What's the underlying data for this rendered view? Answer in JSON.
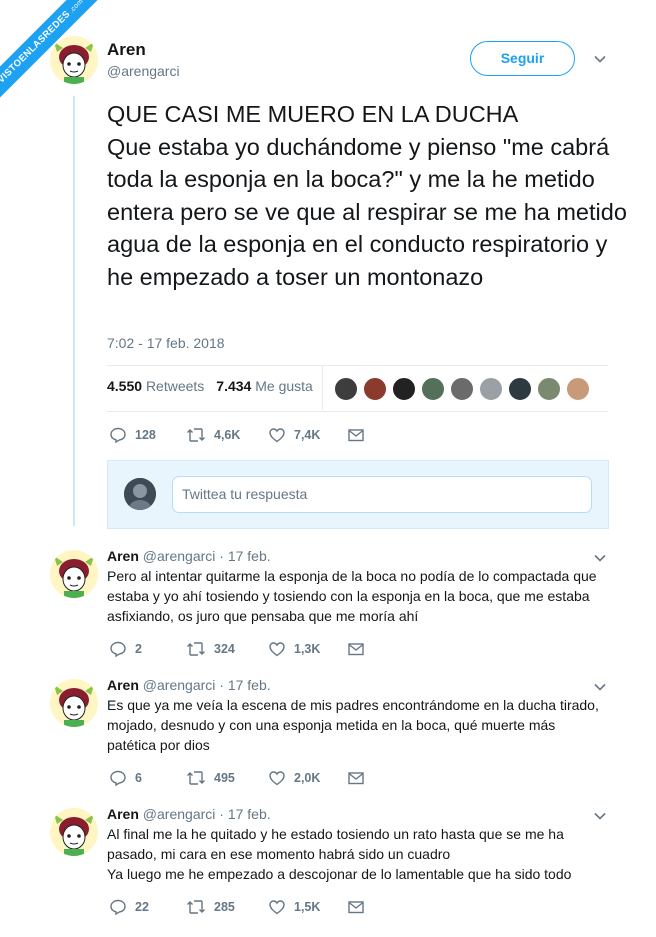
{
  "watermark": {
    "text": "VISTOENLASREDES",
    "sub": ".com"
  },
  "main_tweet": {
    "author_name": "Aren",
    "author_handle": "@arengarci",
    "follow_label": "Seguir",
    "text": "QUE CASI ME MUERO EN LA DUCHA\nQue estaba yo duchándome y pienso \"me cabrá toda la esponja en la boca?\" y me la he metido entera pero se ve que al respirar se me ha metido agua de la esponja en el conducto respiratorio y he empezado a toser un montonazo",
    "timestamp": "7:02 - 17 feb. 2018",
    "retweets_count": "4.550",
    "retweets_label": "Retweets",
    "likes_count": "7.434",
    "likes_label": "Me gusta",
    "reply_count": "128",
    "retweet_action_count": "4,6K",
    "like_action_count": "7,4K",
    "liker_colors": [
      "#3d3d3d",
      "#8a3b2e",
      "#222222",
      "#55705a",
      "#6b6b6b",
      "#9aa0a6",
      "#2e3a40",
      "#7a8a70",
      "#c99a7a"
    ]
  },
  "reply_box": {
    "placeholder": "Twittea tu respuesta"
  },
  "replies": [
    {
      "name": "Aren",
      "handle": "@arengarci",
      "date": "· 17 feb.",
      "lines": [
        "Pero al intentar quitarme la esponja de la boca no podía de lo compactada que",
        "estaba y yo ahí tosiendo y tosiendo con la esponja en la boca, que me estaba",
        "asfixiando, os juro que pensaba que me moría ahí"
      ],
      "reply_count": "2",
      "retweet_count": "324",
      "like_count": "1,3K"
    },
    {
      "name": "Aren",
      "handle": "@arengarci",
      "date": "· 17 feb.",
      "lines": [
        "Es que ya me veía la escena de mis padres encontrándome en la ducha tirado,",
        "mojado, desnudo y con una esponja metida en la boca, qué muerte más",
        "patética por dios"
      ],
      "reply_count": "6",
      "retweet_count": "495",
      "like_count": "2,0K"
    },
    {
      "name": "Aren",
      "handle": "@arengarci",
      "date": "· 17 feb.",
      "lines": [
        "Al final me la he quitado y he estado tosiendo un rato hasta que se me ha",
        "pasado, mi cara en ese momento habrá sido un cuadro",
        "Ya luego me he empezado a descojonar de lo lamentable que ha sido todo"
      ],
      "reply_count": "22",
      "retweet_count": "285",
      "like_count": "1,5K"
    }
  ],
  "colors": {
    "accent": "#1da1f2",
    "muted": "#657786",
    "text": "#14171a",
    "border": "#e6ecf0",
    "reply_box_bg": "#e8f5fd"
  },
  "icons": [
    "reply-icon",
    "retweet-icon",
    "like-icon",
    "message-icon",
    "chevron-down-icon"
  ]
}
